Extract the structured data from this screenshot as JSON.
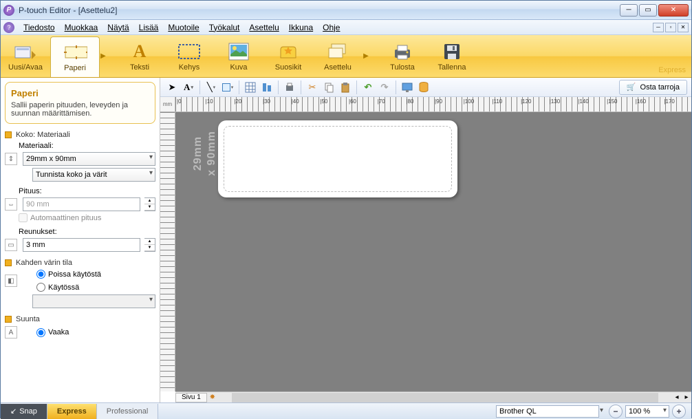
{
  "window": {
    "title": "P-touch Editor - [Asettelu2]"
  },
  "menu": {
    "items": [
      "Tiedosto",
      "Muokkaa",
      "Näytä",
      "Lisää",
      "Muotoile",
      "Työkalut",
      "Asettelu",
      "Ikkuna",
      "Ohje"
    ]
  },
  "ribbon": {
    "new_open": "Uusi/Avaa",
    "paper": "Paperi",
    "text": "Teksti",
    "frame": "Kehys",
    "image": "Kuva",
    "favorites": "Suosikit",
    "layout": "Asettelu",
    "print": "Tulosta",
    "save": "Tallenna",
    "mode": "Express"
  },
  "toolbar2": {
    "buy": "Osta tarroja"
  },
  "sidebar": {
    "title": "Paperi",
    "desc": "Sallii paperin pituuden, leveyden ja suunnan määrittämisen.",
    "size_hdr": "Koko: Materiaali",
    "material_lbl": "Materiaali:",
    "material_val": "29mm x 90mm",
    "detect": "Tunnista koko ja värit",
    "length_lbl": "Pituus:",
    "length_val": "90 mm",
    "auto_len": "Automaattinen pituus",
    "margins_lbl": "Reunukset:",
    "margins_val": "3 mm",
    "twocolor_hdr": "Kahden värin tila",
    "off": "Poissa käytöstä",
    "on": "Käytössä",
    "orient_hdr": "Suunta",
    "horiz": "Vaaka"
  },
  "canvas": {
    "unit": "mm",
    "size_a": "29mm",
    "size_b": "x 90mm",
    "page_tab": "Sivu 1",
    "h_ticks": [
      "|0",
      "|10",
      "|20",
      "|30",
      "|40",
      "|50",
      "|60",
      "|70",
      "|80",
      "|90",
      "|100",
      "|110",
      "|120",
      "|130",
      "|140",
      "|150",
      "|160",
      "|170"
    ]
  },
  "status": {
    "snap": "Snap",
    "express": "Express",
    "pro": "Professional",
    "printer": "Brother QL",
    "zoom": "100 %"
  }
}
